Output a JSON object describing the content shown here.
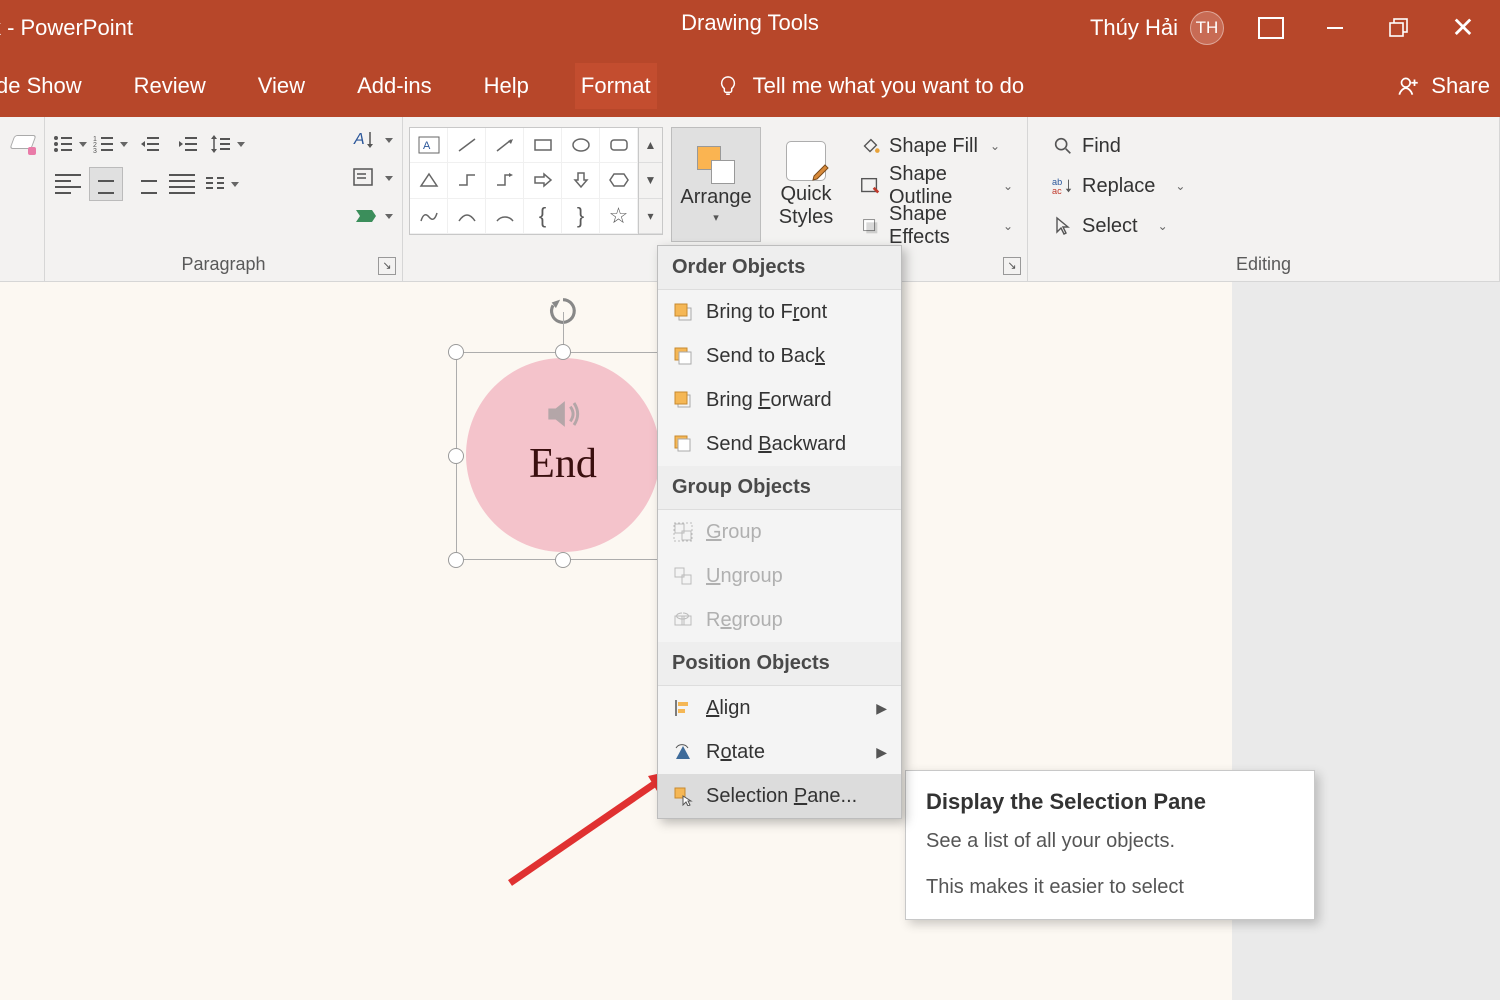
{
  "title_app": "PowerPoint",
  "title_prefix": "k -",
  "drawing_tools": "Drawing Tools",
  "user_name": "Thúy Hải",
  "user_initials": "TH",
  "share": "Share",
  "tabs": {
    "slideshow": "de Show",
    "review": "Review",
    "view": "View",
    "addins": "Add-ins",
    "help": "Help",
    "format": "Format"
  },
  "tell_me": "Tell me what you want to do",
  "ribbon": {
    "paragraph_label": "Paragraph",
    "editing_label": "Editing",
    "arrange": "Arrange",
    "quick_styles": "Quick\nStyles",
    "shape_fill": "Shape Fill",
    "shape_outline": "Shape Outline",
    "shape_effects": "Shape Effects",
    "find": "Find",
    "replace": "Replace",
    "select": "Select"
  },
  "canvas": {
    "circle_text": "End"
  },
  "menu": {
    "order_header": "Order Objects",
    "bring_front": "Bring to Front",
    "bring_front_u": "r",
    "send_back": "Send to Back",
    "send_back_u": "K",
    "bring_fwd": "Bring Forward",
    "bring_fwd_u": "F",
    "send_bwd": "Send Backward",
    "send_bwd_u": "B",
    "group_header": "Group Objects",
    "group": "Group",
    "group_u": "G",
    "ungroup": "Ungroup",
    "ungroup_u": "U",
    "regroup": "Regroup",
    "regroup_u": "e",
    "position_header": "Position Objects",
    "align": "Align",
    "align_u": "A",
    "rotate": "Rotate",
    "rotate_u": "o",
    "selection_pane": "Selection Pane...",
    "selection_pane_u": "P"
  },
  "tooltip": {
    "title": "Display the Selection Pane",
    "line1": "See a list of all your objects.",
    "line2": "This makes it easier to select"
  }
}
